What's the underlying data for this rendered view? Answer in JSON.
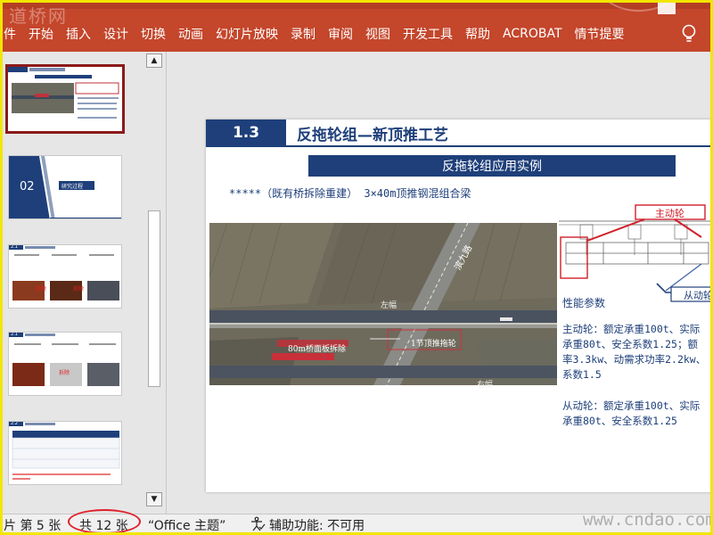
{
  "watermark_logo": "道桥网",
  "watermark_url": "www.cndao.com",
  "ribbon": {
    "tabs": [
      "件",
      "开始",
      "插入",
      "设计",
      "切换",
      "动画",
      "幻灯片放映",
      "录制",
      "审阅",
      "视图",
      "开发工具",
      "帮助",
      "ACROBAT",
      "情节提要"
    ]
  },
  "thumbnails": [
    {
      "type": "slide-1-3",
      "selected": true
    },
    {
      "number": "02",
      "label": "研究过程"
    },
    {
      "label": "2.1",
      "tags": [
        "拆除",
        "拆除"
      ]
    },
    {
      "label": "2.1",
      "tags": [
        "拆除"
      ]
    },
    {
      "label": "2.2"
    }
  ],
  "slide": {
    "number": "1.3",
    "title": "反拖轮组—新顶推工艺",
    "subtitle": "反拖轮组应用实例",
    "description": "*****（既有桥拆除重建） 3×40m顶推钢混组合梁",
    "photo_labels": {
      "road": "滨九路",
      "left": "左幅",
      "right": "右幅",
      "demolish": "80m桥面板拆除",
      "jack": "1节顶推拖轮"
    },
    "diagram_labels": {
      "main_wheel": "主动轮",
      "driven_wheel": "从动轮"
    },
    "params_title": "性能参数",
    "main_wheel_lines": [
      "主动轮：额定承重100t、实际",
      "承重80t、安全系数1.25；额",
      "率3.3kw、动需求功率2.2kw、",
      "系数1.5"
    ],
    "driven_wheel_lines": [
      "从动轮：额定承重100t、实际",
      "承重80t、安全系数1.25"
    ]
  },
  "statusbar": {
    "slide_pos": "片 第 5 张",
    "total": "共 12 张",
    "theme": "“Office 主题”",
    "accessibility": "辅助功能: 不可用"
  }
}
